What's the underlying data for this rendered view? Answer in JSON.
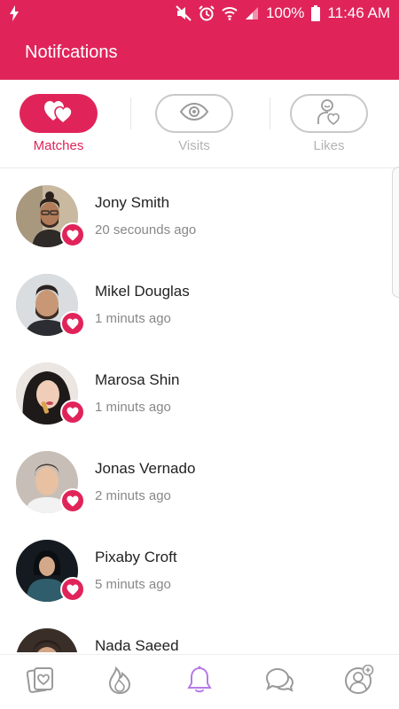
{
  "status_bar": {
    "battery_percent": "100%",
    "time": "11:46 AM"
  },
  "header": {
    "title": "Notifcations"
  },
  "tabs": [
    {
      "label": "Matches",
      "icon": "hearts-icon",
      "active": true
    },
    {
      "label": "Visits",
      "icon": "eye-icon",
      "active": false
    },
    {
      "label": "Likes",
      "icon": "person-heart-icon",
      "active": false
    }
  ],
  "notifications": [
    {
      "name": "Jony Smith",
      "time": "20 secounds ago"
    },
    {
      "name": "Mikel Douglas",
      "time": "1 minuts ago"
    },
    {
      "name": "Marosa Shin",
      "time": "1 minuts ago"
    },
    {
      "name": "Jonas Vernado",
      "time": "2 minuts ago"
    },
    {
      "name": "Pixaby Croft",
      "time": "5 minuts ago"
    },
    {
      "name": "Nada Saeed",
      "time": ""
    }
  ],
  "bottom_nav": [
    {
      "icon": "cards-icon",
      "active": false
    },
    {
      "icon": "flame-icon",
      "active": false
    },
    {
      "icon": "bell-icon",
      "active": true
    },
    {
      "icon": "chat-icon",
      "active": false
    },
    {
      "icon": "profile-add-icon",
      "active": false
    }
  ],
  "colors": {
    "accent": "#e0245a",
    "nav_active": "#b57be6",
    "icon_inactive": "#9a9a9a"
  }
}
